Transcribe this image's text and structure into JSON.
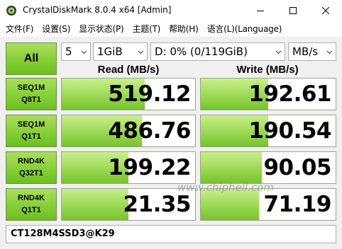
{
  "window": {
    "title": "CrystalDiskMark 8.0.4 x64 [Admin]"
  },
  "menu": {
    "file": "文件(F)",
    "settings": "设置(S)",
    "display": "显示状态(P)",
    "theme": "主题(T)",
    "help": "帮助(H)",
    "language": "语言(L)(Language)"
  },
  "controls": {
    "all_label": "All",
    "count": "5",
    "size": "1GiB",
    "drive": "D: 0% (0/119GiB)",
    "unit": "MB/s"
  },
  "headers": {
    "read": "Read (MB/s)",
    "write": "Write (MB/s)"
  },
  "tests": [
    {
      "line1": "SEQ1M",
      "line2": "Q8T1",
      "read": "519.12",
      "write": "192.61",
      "read_fill": 0.62,
      "write_fill": 0.5
    },
    {
      "line1": "SEQ1M",
      "line2": "Q1T1",
      "read": "486.76",
      "write": "190.54",
      "read_fill": 0.6,
      "write_fill": 0.5
    },
    {
      "line1": "RND4K",
      "line2": "Q32T1",
      "read": "199.22",
      "write": "90.05",
      "read_fill": 0.5,
      "write_fill": 0.45
    },
    {
      "line1": "RND4K",
      "line2": "Q1T1",
      "read": "21.35",
      "write": "71.19",
      "read_fill": 0.5,
      "write_fill": 0.43
    }
  ],
  "comment": "CT128M4SSD3@K29",
  "watermark": "www.chiphell.com",
  "colors": {
    "accent_green": "#76c42a",
    "label_green": "#8fd141"
  }
}
